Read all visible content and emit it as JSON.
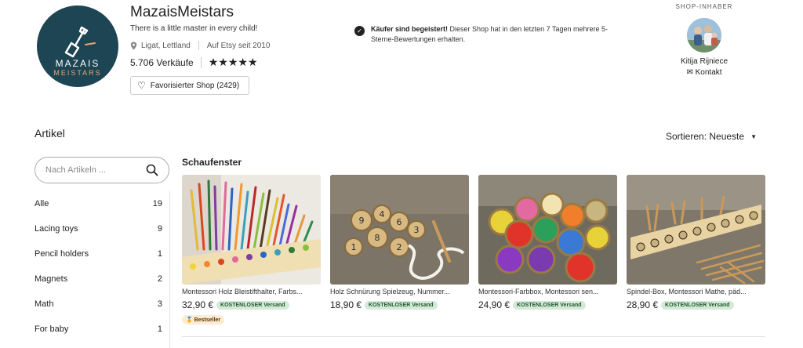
{
  "shop": {
    "logo_line1": "MAZAIS",
    "logo_line2": "MEISTARS",
    "name": "MazaisMeistars",
    "tagline": "There is a little master in every child!",
    "location": "Ligat, Lettland",
    "since": "Auf Etsy seit 2010",
    "sales": "5.706 Verkäufe",
    "rating_stars": "★★★★★",
    "rating": 5,
    "favorite_label": "Favorisierter Shop (2429)"
  },
  "notice": {
    "bold": "Käufer sind begeistert!",
    "text": " Dieser Shop hat in den letzten 7 Tagen mehrere 5-Sterne-Bewertungen erhalten."
  },
  "owner": {
    "heading": "SHOP-INHABER",
    "name": "Kitija Rijniece",
    "contact": "Kontakt"
  },
  "items_section": {
    "title": "Artikel",
    "sort_label": "Sortieren: Neueste",
    "search_placeholder": "Nach Artikeln ...",
    "categories": [
      {
        "label": "Alle",
        "count": "19"
      },
      {
        "label": "Lacing toys",
        "count": "9"
      },
      {
        "label": "Pencil holders",
        "count": "1"
      },
      {
        "label": "Magnets",
        "count": "2"
      },
      {
        "label": "Math",
        "count": "3"
      },
      {
        "label": "For baby",
        "count": "1"
      }
    ]
  },
  "showcase": {
    "title": "Schaufenster",
    "products": [
      {
        "title": "Montessori Holz Bleistifthalter, Farbs...",
        "price": "32,90 €",
        "shipping": "KOSTENLOSER Versand",
        "badge": "Bestseller"
      },
      {
        "title": "Holz Schnürung Spielzeug, Nummer...",
        "price": "18,90 €",
        "shipping": "KOSTENLOSER Versand"
      },
      {
        "title": "Montessori-Farbbox, Montessori sen...",
        "price": "24,90 €",
        "shipping": "KOSTENLOSER Versand"
      },
      {
        "title": "Spindel-Box, Montessori Mathe, päd...",
        "price": "28,90 €",
        "shipping": "KOSTENLOSER Versand"
      }
    ]
  },
  "colors": {
    "logo_bg": "#1e4553",
    "logo_accent": "#e8a47a",
    "free_shipping_bg": "#d4e9d7",
    "bestseller_bg": "#fdebd2"
  },
  "icons": {
    "location": "location-pin-icon",
    "favorite": "heart-icon",
    "notice": "chat-bubble-icon",
    "contact": "envelope-icon",
    "search": "search-icon",
    "sort": "caret-down-icon",
    "bestseller": "medal-icon"
  }
}
